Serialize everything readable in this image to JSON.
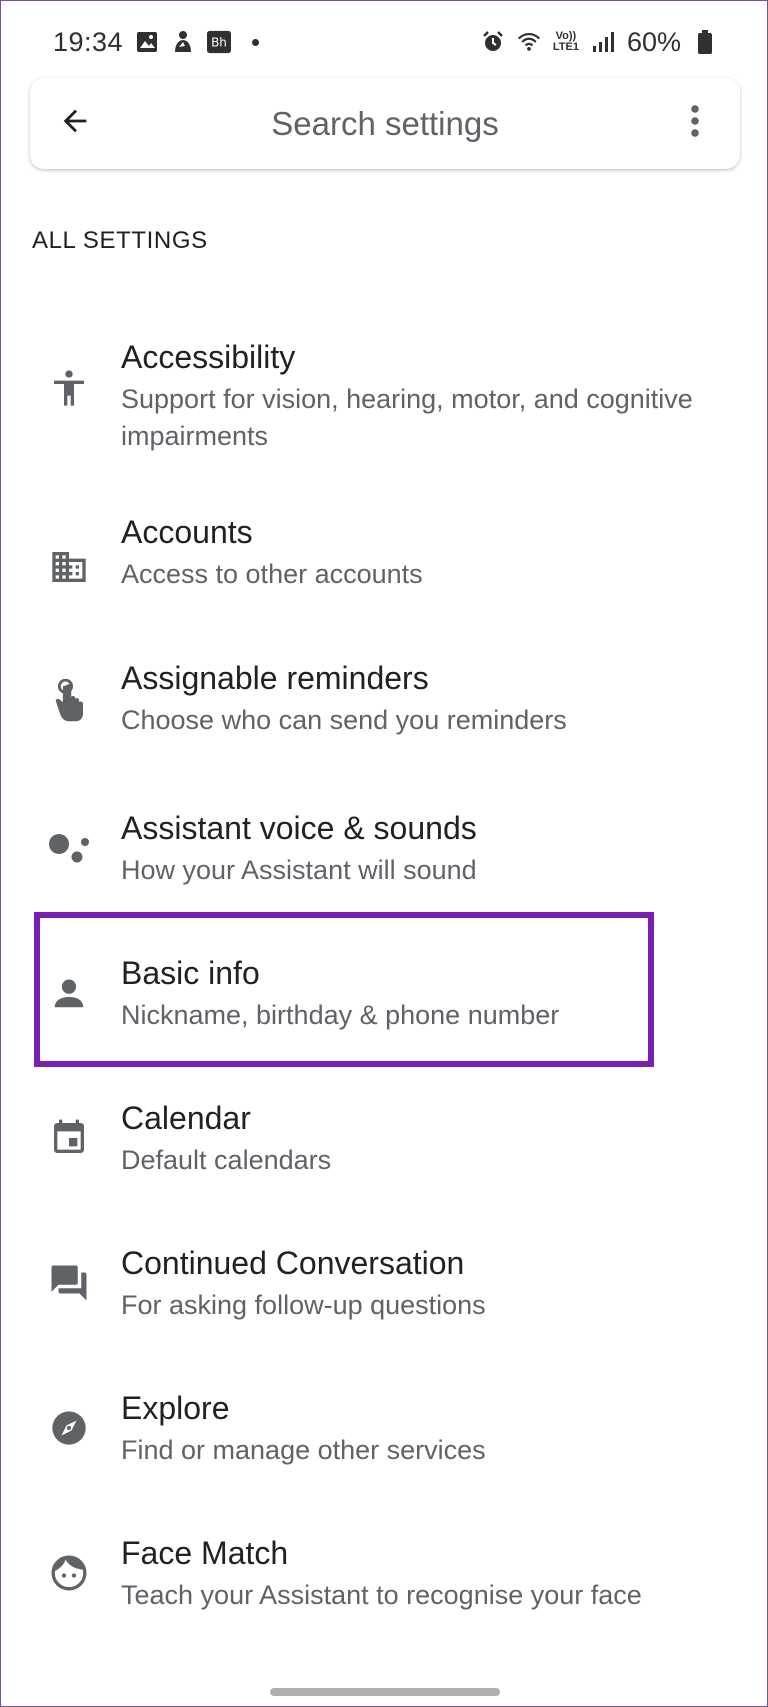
{
  "status_bar": {
    "time": "19:34",
    "battery": "60%",
    "network_label_top": "Vo))",
    "network_label_bottom": "LTE1",
    "icons": [
      "gallery-icon",
      "app-icon",
      "bh-icon",
      "dot-icon",
      "alarm-icon",
      "wifi-icon",
      "signal-icon",
      "battery-icon"
    ]
  },
  "search": {
    "placeholder": "Search settings",
    "back_icon": "arrow-back-icon",
    "more_icon": "more-vert-icon"
  },
  "section_header": "ALL SETTINGS",
  "settings": [
    {
      "title": "Accessibility",
      "subtitle": "Support for vision, hearing, motor, and cognitive impairments",
      "icon": "accessibility-icon"
    },
    {
      "title": "Accounts",
      "subtitle": "Access to other accounts",
      "icon": "building-icon"
    },
    {
      "title": "Assignable reminders",
      "subtitle": "Choose who can send you reminders",
      "icon": "touch-hand-icon"
    },
    {
      "title": "Assistant voice & sounds",
      "subtitle": "How your Assistant will sound",
      "icon": "assistant-dots-icon"
    },
    {
      "title": "Basic info",
      "subtitle": "Nickname, birthday & phone number",
      "icon": "person-icon"
    },
    {
      "title": "Calendar",
      "subtitle": "Default calendars",
      "icon": "calendar-icon"
    },
    {
      "title": "Continued Conversation",
      "subtitle": "For asking follow-up questions",
      "icon": "chat-bubbles-icon"
    },
    {
      "title": "Explore",
      "subtitle": "Find or manage other services",
      "icon": "compass-icon"
    },
    {
      "title": "Face Match",
      "subtitle": "Teach your Assistant to recognise your face",
      "icon": "face-icon"
    }
  ],
  "colors": {
    "highlight": "#7b1fb5",
    "icon": "#5f6368",
    "title": "#202124",
    "subtitle": "#5f6368"
  }
}
